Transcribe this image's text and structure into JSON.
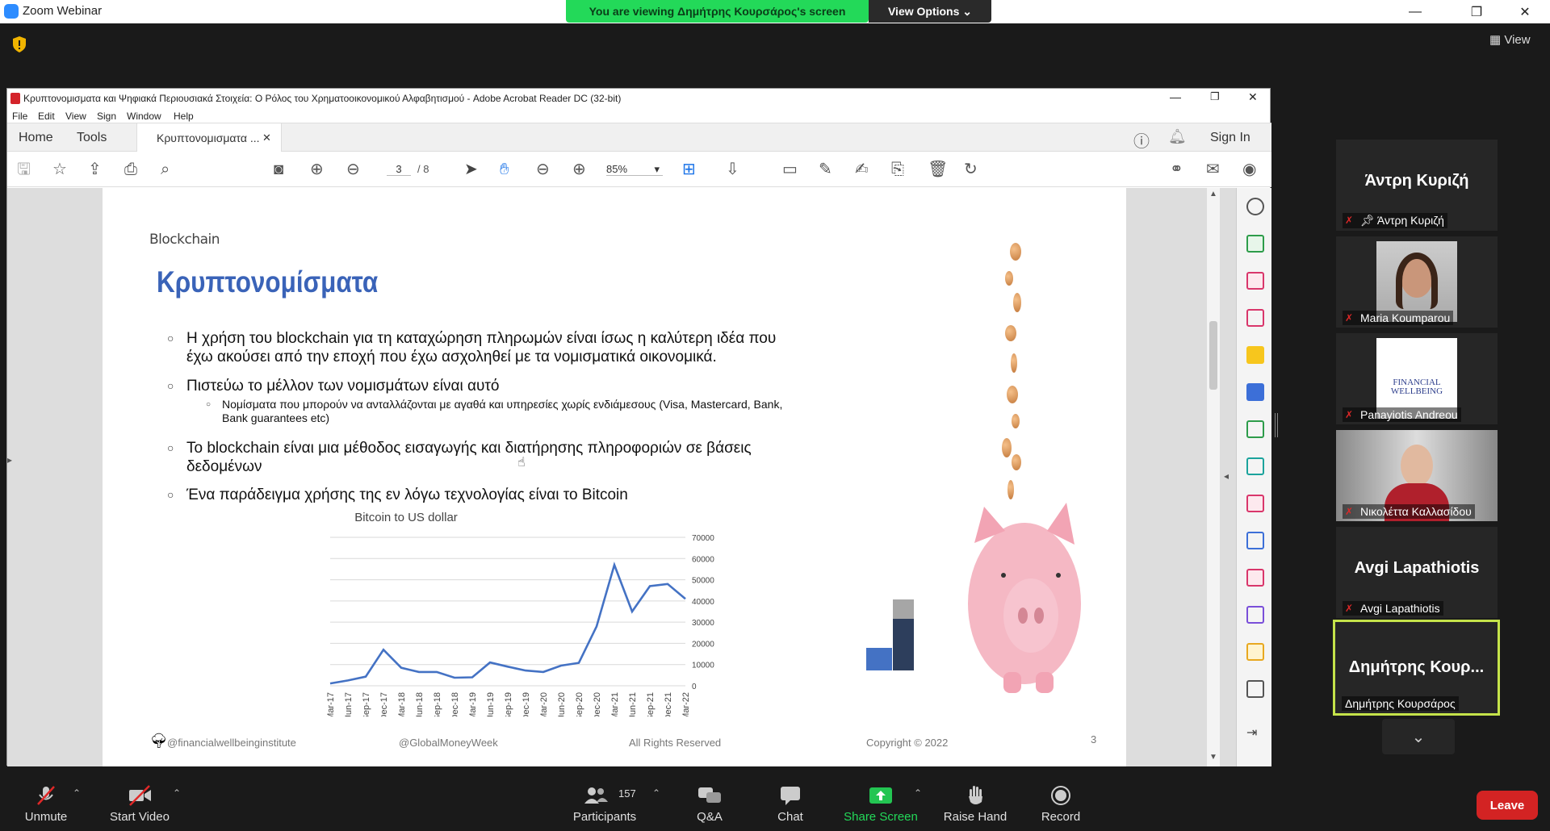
{
  "window": {
    "title": "Zoom Webinar"
  },
  "banner": {
    "viewing": "You are viewing Δημήτρης Κουρσάρος's screen",
    "view_options": "View Options"
  },
  "view_button": "View",
  "acrobat": {
    "title": "Κρυπτονομισματα και Ψηφιακά Περιουσιακά Στοιχεία: Ο Ρόλος του Χρηματοοικονομικού Αλφαβητισμού - Adobe Acrobat Reader DC (32-bit)",
    "menu": [
      "File",
      "Edit",
      "View",
      "Sign",
      "Window",
      "Help"
    ],
    "tabs": {
      "home": "Home",
      "tools": "Tools",
      "doc": "Κρυπτονομισματα ..."
    },
    "sign_in": "Sign In",
    "page_current": "3",
    "page_total": "/ 8",
    "zoom": "85%"
  },
  "slide": {
    "header": "Blockchain",
    "title": "Κρυπτονομίσματα",
    "bullet1": "Η χρήση του blockchain για τη καταχώρηση πληρωμών είναι ίσως η καλύτερη ιδέα που",
    "bullet1b": "έχω ακούσει από την εποχή που έχω ασχοληθεί με τα νομισματικά οικονομικά.",
    "bullet2": "Πιστεύω το μέλλον των νομισμάτων είναι αυτό",
    "sub1": "Νομίσματα που μπορούν να ανταλλάζονται με αγαθά και υπηρεσίες χωρίς ενδιάμεσους (Visa, Mastercard, Bank,",
    "sub1b": "Bank guarantees etc)",
    "bullet3": "Το blockchain είναι μια μέθοδος εισαγωγής και διατήρησης πληροφοριών σε βάσεις",
    "bullet3b": "δεδομένων",
    "bullet4": "Ένα παράδειγμα χρήσης της εν λόγω τεχνολογίας είναι το Bitcoin",
    "footer_handle": "@financialwellbeinginstitute",
    "footer_gmw": "@GlobalMoneyWeek",
    "footer_rights": "All Rights Reserved",
    "footer_copy": "Copyright © 2022",
    "footer_page": "3",
    "logo_text": "FINANCIAL WELLBEING"
  },
  "chart_data": {
    "type": "line",
    "title": "Bitcoin to US dollar",
    "x": [
      "Mar-17",
      "Jun-17",
      "Sep-17",
      "Dec-17",
      "Mar-18",
      "Jun-18",
      "Sep-18",
      "Dec-18",
      "Mar-19",
      "Jun-19",
      "Sep-19",
      "Dec-19",
      "Mar-20",
      "Jun-20",
      "Sep-20",
      "Dec-20",
      "Mar-21",
      "Jun-21",
      "Sep-21",
      "Dec-21",
      "Mar-22"
    ],
    "values": [
      1100,
      2500,
      4300,
      17000,
      8500,
      6500,
      6500,
      3800,
      4000,
      11000,
      9000,
      7200,
      6500,
      9500,
      10800,
      28000,
      57000,
      35000,
      47000,
      48000,
      41000
    ],
    "ylim": [
      0,
      70000
    ],
    "yticks": [
      "70000",
      "60000",
      "50000",
      "40000",
      "30000",
      "20000",
      "10000",
      "0"
    ],
    "color": "#4472c4"
  },
  "participants": [
    {
      "big": "Άντρη Κυριζή",
      "name": "Άντρη Κυριζή",
      "pinned": true
    },
    {
      "big": "",
      "name": "Maria Koumparou"
    },
    {
      "big": "",
      "name": "Panayiotis Andreou"
    },
    {
      "big": "",
      "name": "Νικολέττα Καλλασίδου"
    },
    {
      "big": "Avgi Lapathiotis",
      "name": "Avgi Lapathiotis"
    },
    {
      "big": "Δημήτρης Κουρ...",
      "name": "Δημήτρης Κουρσάρος"
    }
  ],
  "bottom": {
    "unmute": "Unmute",
    "start_video": "Start Video",
    "participants": "Participants",
    "participants_count": "157",
    "qa": "Q&A",
    "chat": "Chat",
    "share": "Share Screen",
    "raise": "Raise Hand",
    "record": "Record",
    "leave": "Leave"
  }
}
